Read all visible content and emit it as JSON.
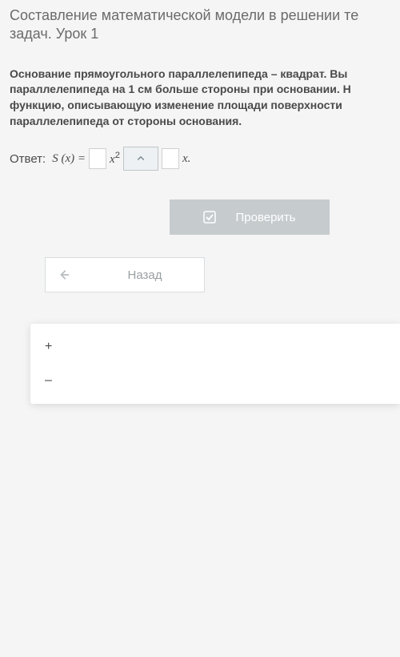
{
  "title": "Составление математической модели в решении те задач. Урок 1",
  "question": "Основание прямоугольного параллелепипеда – квадрат. Вы параллелепипеда на 1 см больше стороны при основании. Н функцию, описывающую изменение площади поверхности параллелепипеда от стороны основания.",
  "answer": {
    "label": "Ответ:",
    "func": "S (x) =",
    "sq": "x",
    "sq_exp": "2",
    "tail": "x."
  },
  "buttons": {
    "check": "Проверить",
    "back": "Назад"
  },
  "dropdown": {
    "plus": "+",
    "minus": "–"
  }
}
